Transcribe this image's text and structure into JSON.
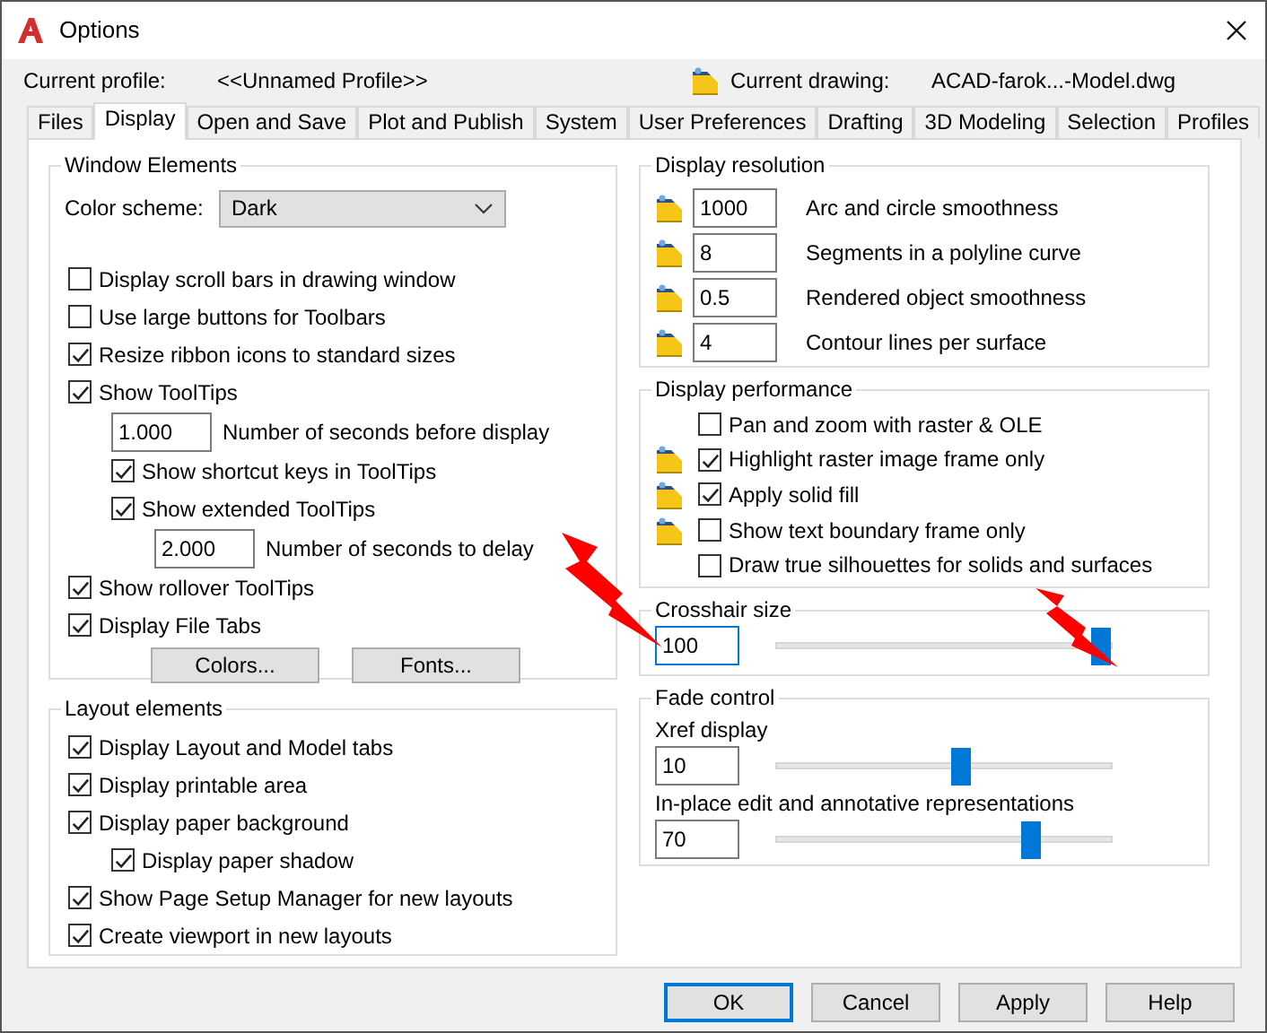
{
  "window": {
    "title": "Options"
  },
  "profile": {
    "label": "Current profile:",
    "value": "<<Unnamed Profile>>",
    "drawing_label": "Current drawing:",
    "drawing_value": "ACAD-farok...-Model.dwg"
  },
  "tabs": [
    {
      "label": "Files",
      "selected": false
    },
    {
      "label": "Display",
      "selected": true
    },
    {
      "label": "Open and Save",
      "selected": false
    },
    {
      "label": "Plot and Publish",
      "selected": false
    },
    {
      "label": "System",
      "selected": false
    },
    {
      "label": "User Preferences",
      "selected": false
    },
    {
      "label": "Drafting",
      "selected": false
    },
    {
      "label": "3D Modeling",
      "selected": false
    },
    {
      "label": "Selection",
      "selected": false
    },
    {
      "label": "Profiles",
      "selected": false
    }
  ],
  "window_elements": {
    "title": "Window Elements",
    "color_scheme": {
      "label": "Color scheme:",
      "value": "Dark"
    },
    "items": [
      {
        "kind": "check",
        "label": "Display scroll bars in drawing window",
        "checked": false
      },
      {
        "kind": "check",
        "label": "Use large buttons for Toolbars",
        "checked": false
      },
      {
        "kind": "check",
        "label": "Resize ribbon icons to standard sizes",
        "checked": true
      },
      {
        "kind": "check",
        "label": "Show ToolTips",
        "checked": true,
        "children": [
          {
            "kind": "number",
            "value": "1.000",
            "label": "Number of seconds before display"
          },
          {
            "kind": "check",
            "label": "Show shortcut keys in ToolTips",
            "checked": true
          },
          {
            "kind": "check",
            "label": "Show extended ToolTips",
            "checked": true,
            "children": [
              {
                "kind": "number",
                "value": "2.000",
                "label": "Number of seconds to delay"
              }
            ]
          }
        ]
      },
      {
        "kind": "check",
        "label": "Show rollover ToolTips",
        "checked": true
      },
      {
        "kind": "check",
        "label": "Display File Tabs",
        "checked": true
      }
    ],
    "buttons": [
      "Colors...",
      "Fonts..."
    ]
  },
  "layout_elements": {
    "title": "Layout elements",
    "items": [
      {
        "kind": "check",
        "label": "Display Layout and Model tabs",
        "checked": true
      },
      {
        "kind": "check",
        "label": "Display printable area",
        "checked": true
      },
      {
        "kind": "check",
        "label": "Display paper background",
        "checked": true,
        "children": [
          {
            "kind": "check",
            "label": "Display paper shadow",
            "checked": true
          }
        ]
      },
      {
        "kind": "check",
        "label": "Show Page Setup Manager for new layouts",
        "checked": true
      },
      {
        "kind": "check",
        "label": "Create viewport in new layouts",
        "checked": true
      }
    ]
  },
  "display_resolution": {
    "title": "Display resolution",
    "rows": [
      {
        "value": "1000",
        "label": "Arc and circle smoothness"
      },
      {
        "value": "8",
        "label": "Segments in a polyline curve"
      },
      {
        "value": "0.5",
        "label": "Rendered object smoothness"
      },
      {
        "value": "4",
        "label": "Contour lines per surface"
      }
    ]
  },
  "display_performance": {
    "title": "Display performance",
    "items": [
      {
        "label": "Pan and zoom with raster & OLE",
        "checked": false,
        "drawing_icon": false
      },
      {
        "label": "Highlight raster image frame only",
        "checked": true,
        "drawing_icon": true
      },
      {
        "label": "Apply solid fill",
        "checked": true,
        "drawing_icon": true
      },
      {
        "label": "Show text boundary frame only",
        "checked": false,
        "drawing_icon": true
      },
      {
        "label": "Draw true silhouettes for solids and surfaces",
        "checked": false,
        "drawing_icon": false
      }
    ]
  },
  "crosshair": {
    "title": "Crosshair size",
    "value": "100",
    "level": 0.97
  },
  "fade_control": {
    "title": "Fade control",
    "sliders": [
      {
        "label": "Xref display",
        "value": "10",
        "level": 0.55
      },
      {
        "label": "In-place edit and annotative representations",
        "value": "70",
        "level": 0.76
      }
    ]
  },
  "buttons": [
    {
      "label": "OK",
      "default": true
    },
    {
      "label": "Cancel",
      "default": false
    },
    {
      "label": "Apply",
      "default": false
    },
    {
      "label": "Help",
      "default": false
    }
  ]
}
